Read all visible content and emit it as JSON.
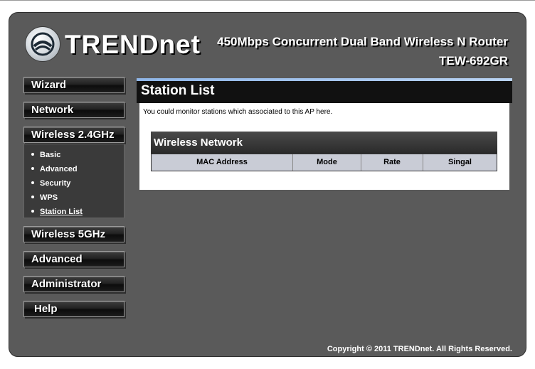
{
  "header": {
    "brand": "TRENDnet",
    "product_title": "450Mbps Concurrent Dual Band Wireless N Router",
    "model": "TEW-692GR"
  },
  "nav": {
    "wizard": "Wizard",
    "network": "Network",
    "wireless24": "Wireless 2.4GHz",
    "wireless24_items": [
      "Basic",
      "Advanced",
      "Security",
      "WPS",
      "Station List"
    ],
    "wireless5": "Wireless 5GHz",
    "advanced": "Advanced",
    "administrator": "Administrator",
    "help": "Help"
  },
  "content": {
    "title": "Station List",
    "description": "You could monitor stations which associated to this AP here.",
    "table_title": "Wireless Network",
    "columns": [
      "MAC Address",
      "Mode",
      "Rate",
      "Singal"
    ]
  },
  "footer": {
    "copyright": "Copyright © 2011 TRENDnet. All Rights Reserved."
  },
  "colors": {
    "frame": "#5a5a5a",
    "accent_bar": "#8fb6e8",
    "table_header": "#c9ccd6"
  }
}
